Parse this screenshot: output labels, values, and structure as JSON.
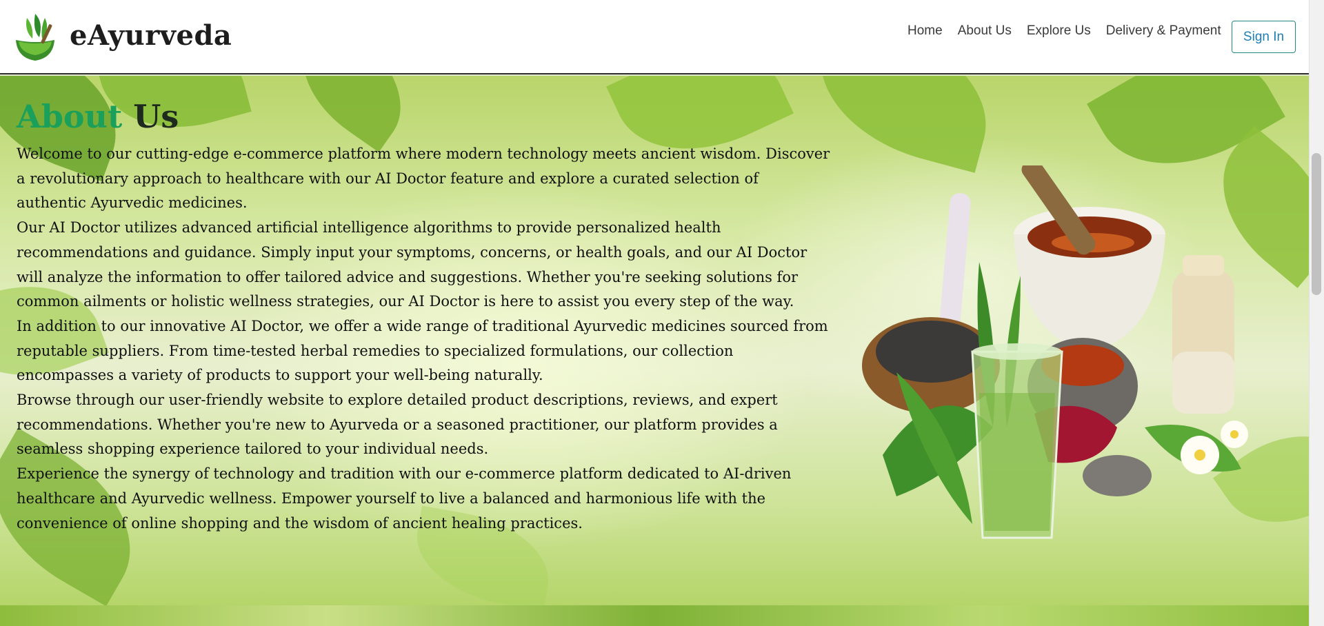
{
  "header": {
    "brand": "eAyurveda",
    "nav": [
      "Home",
      "About Us",
      "Explore Us",
      "Delivery & Payment"
    ],
    "signin_label": "Sign In"
  },
  "about": {
    "heading_part1": "About",
    "heading_part2": "Us",
    "paragraphs": [
      "Welcome to our cutting-edge e-commerce platform where modern technology meets ancient wisdom. Discover a revolutionary approach to healthcare with our AI Doctor feature and explore a curated selection of authentic Ayurvedic medicines.",
      "Our AI Doctor utilizes advanced artificial intelligence algorithms to provide personalized health recommendations and guidance. Simply input your symptoms, concerns, or health goals, and our AI Doctor will analyze the information to offer tailored advice and suggestions. Whether you're seeking solutions for common ailments or holistic wellness strategies, our AI Doctor is here to assist you every step of the way.",
      "In addition to our innovative AI Doctor, we offer a wide range of traditional Ayurvedic medicines sourced from reputable suppliers. From time-tested herbal remedies to specialized formulations, our collection encompasses a variety of products to support your well-being naturally.",
      "Browse through our user-friendly website to explore detailed product descriptions, reviews, and expert recommendations. Whether you're new to Ayurveda or a seasoned practitioner, our platform provides a seamless shopping experience tailored to your individual needs.",
      "Experience the synergy of technology and tradition with our e-commerce platform dedicated to AI-driven healthcare and Ayurvedic wellness. Empower yourself to live a balanced and harmonious life with the convenience of online shopping and the wisdom of ancient healing practices."
    ]
  },
  "icons": {
    "logo": "mortar-leaf-logo-icon",
    "illustration": "ayurvedic-herbs-illustration"
  },
  "colors": {
    "heading_green": "#1aa05a",
    "signin_border": "#1f8a82",
    "signin_text": "#1f7fb5"
  }
}
